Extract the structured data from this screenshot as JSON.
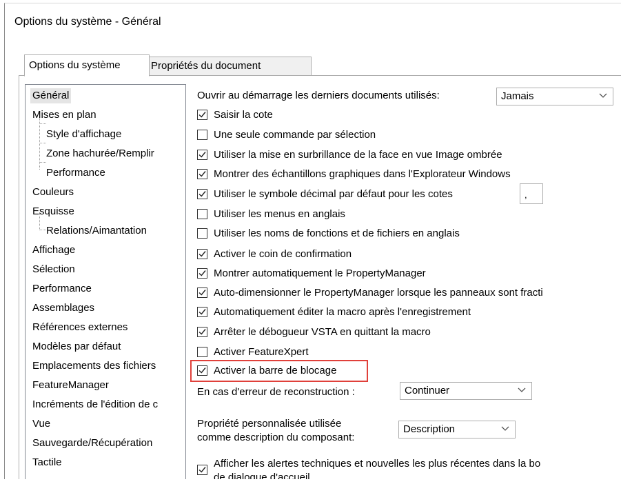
{
  "window": {
    "title": "Options du système - Général"
  },
  "tabs": [
    {
      "label": "Options du système",
      "active": true
    },
    {
      "label": "Propriétés du document",
      "active": false
    }
  ],
  "tree": {
    "items": [
      {
        "label": "Général",
        "selected": true,
        "level": 0
      },
      {
        "label": "Mises en plan",
        "level": 0
      },
      {
        "label": "Style d'affichage",
        "level": 1
      },
      {
        "label": "Zone hachurée/Remplir",
        "level": 1
      },
      {
        "label": "Performance",
        "level": 1
      },
      {
        "label": "Couleurs",
        "level": 0
      },
      {
        "label": "Esquisse",
        "level": 0
      },
      {
        "label": "Relations/Aimantation",
        "level": 1
      },
      {
        "label": "Affichage",
        "level": 0
      },
      {
        "label": "Sélection",
        "level": 0
      },
      {
        "label": "Performance",
        "level": 0
      },
      {
        "label": "Assemblages",
        "level": 0
      },
      {
        "label": "Références externes",
        "level": 0
      },
      {
        "label": "Modèles par défaut",
        "level": 0
      },
      {
        "label": "Emplacements des fichiers",
        "level": 0
      },
      {
        "label": "FeatureManager",
        "level": 0
      },
      {
        "label": "Incréments de l'édition de c",
        "level": 0
      },
      {
        "label": "Vue",
        "level": 0
      },
      {
        "label": "Sauvegarde/Récupération",
        "level": 0
      },
      {
        "label": "Tactile",
        "level": 0
      }
    ]
  },
  "general": {
    "recent_docs_label": "Ouvrir au démarrage les derniers documents utilisés:",
    "recent_docs_value": "Jamais",
    "decimal_symbol_value": ",",
    "checkboxes": [
      {
        "label": "Saisir la cote",
        "checked": true
      },
      {
        "label": "Une seule commande par sélection",
        "checked": false
      },
      {
        "label": "Utiliser la mise en surbrillance de la face en vue Image ombrée",
        "checked": true
      },
      {
        "label": "Montrer des échantillons graphiques dans l'Explorateur Windows",
        "checked": true
      },
      {
        "label": "Utiliser le symbole décimal par défaut pour les cotes",
        "checked": true
      },
      {
        "label": "Utiliser les menus en anglais",
        "checked": false
      },
      {
        "label": "Utiliser les noms de fonctions et de fichiers en anglais",
        "checked": false
      },
      {
        "label": "Activer le coin de confirmation",
        "checked": true
      },
      {
        "label": "Montrer automatiquement le PropertyManager",
        "checked": true
      },
      {
        "label": "Auto-dimensionner le PropertyManager lorsque les panneaux sont fracti",
        "checked": true
      },
      {
        "label": "Automatiquement éditer la macro après l'enregistrement",
        "checked": true
      },
      {
        "label": "Arrêter le débogueur VSTA en quittant la macro",
        "checked": true
      },
      {
        "label": "Activer FeatureXpert",
        "checked": false
      },
      {
        "label": "Activer la barre de blocage",
        "checked": true
      }
    ],
    "rebuild_error_label": "En cas d'erreur de reconstruction :",
    "rebuild_error_value": "Continuer",
    "custom_prop_label_1": "Propriété personnalisée utilisée",
    "custom_prop_label_2": "comme description du composant:",
    "custom_prop_value": "Description",
    "alerts_label_1": "Afficher les alertes techniques et nouvelles les plus récentes dans la bo",
    "alerts_label_2": "de dialogue d'accueil",
    "alerts_checked": true
  },
  "colors": {
    "highlight": "#e0403a",
    "selected_tree_bg": "#e5e5e5"
  }
}
